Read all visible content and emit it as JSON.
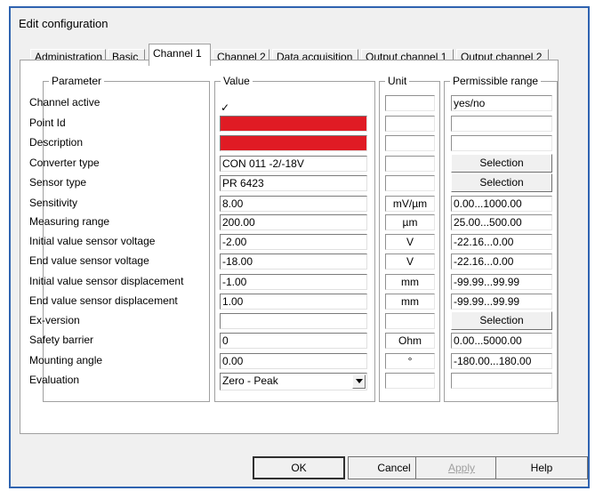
{
  "window": {
    "title": "Edit configuration"
  },
  "tabs": [
    "Administration",
    "Basic",
    "Channel 1",
    "Channel 2",
    "Data acquisition",
    "Output channel 1",
    "Output channel 2"
  ],
  "columns": {
    "parameter": "Parameter",
    "value": "Value",
    "unit": "Unit",
    "range": "Permissible range"
  },
  "rows": [
    {
      "param": "Channel active",
      "value": "✓",
      "unit": "",
      "range": "yes/no"
    },
    {
      "param": "Point Id",
      "value": "",
      "unit": "",
      "range": ""
    },
    {
      "param": "Description",
      "value": "",
      "unit": "",
      "range": ""
    },
    {
      "param": "Converter type",
      "value": "CON 011 -2/-18V",
      "unit": "",
      "range": "Selection"
    },
    {
      "param": "Sensor type",
      "value": "PR 6423",
      "unit": "",
      "range": "Selection"
    },
    {
      "param": "Sensitivity",
      "value": "8.00",
      "unit": "mV/µm",
      "range": "0.00...1000.00"
    },
    {
      "param": "Measuring range",
      "value": "200.00",
      "unit": "µm",
      "range": "25.00...500.00"
    },
    {
      "param": "Initial value sensor voltage",
      "value": "-2.00",
      "unit": "V",
      "range": "-22.16...0.00"
    },
    {
      "param": "End value sensor voltage",
      "value": "-18.00",
      "unit": "V",
      "range": "-22.16...0.00"
    },
    {
      "param": "Initial value sensor displacement",
      "value": "-1.00",
      "unit": "mm",
      "range": "-99.99...99.99"
    },
    {
      "param": "End value sensor displacement",
      "value": "1.00",
      "unit": "mm",
      "range": "-99.99...99.99"
    },
    {
      "param": "Ex-version",
      "value": "",
      "unit": "",
      "range": "Selection"
    },
    {
      "param": "Safety barrier",
      "value": "0",
      "unit": "Ohm",
      "range": "0.00...5000.00"
    },
    {
      "param": "Mounting angle",
      "value": "0.00",
      "unit": "°",
      "range": "-180.00...180.00"
    },
    {
      "param": "Evaluation",
      "value": "Zero - Peak",
      "unit": "",
      "range": ""
    }
  ],
  "buttons": {
    "ok": "OK",
    "cancel": "Cancel",
    "apply": "Apply",
    "help": "Help"
  },
  "colors": {
    "error_field": "#e01b24",
    "window_border": "#2f63b0"
  }
}
